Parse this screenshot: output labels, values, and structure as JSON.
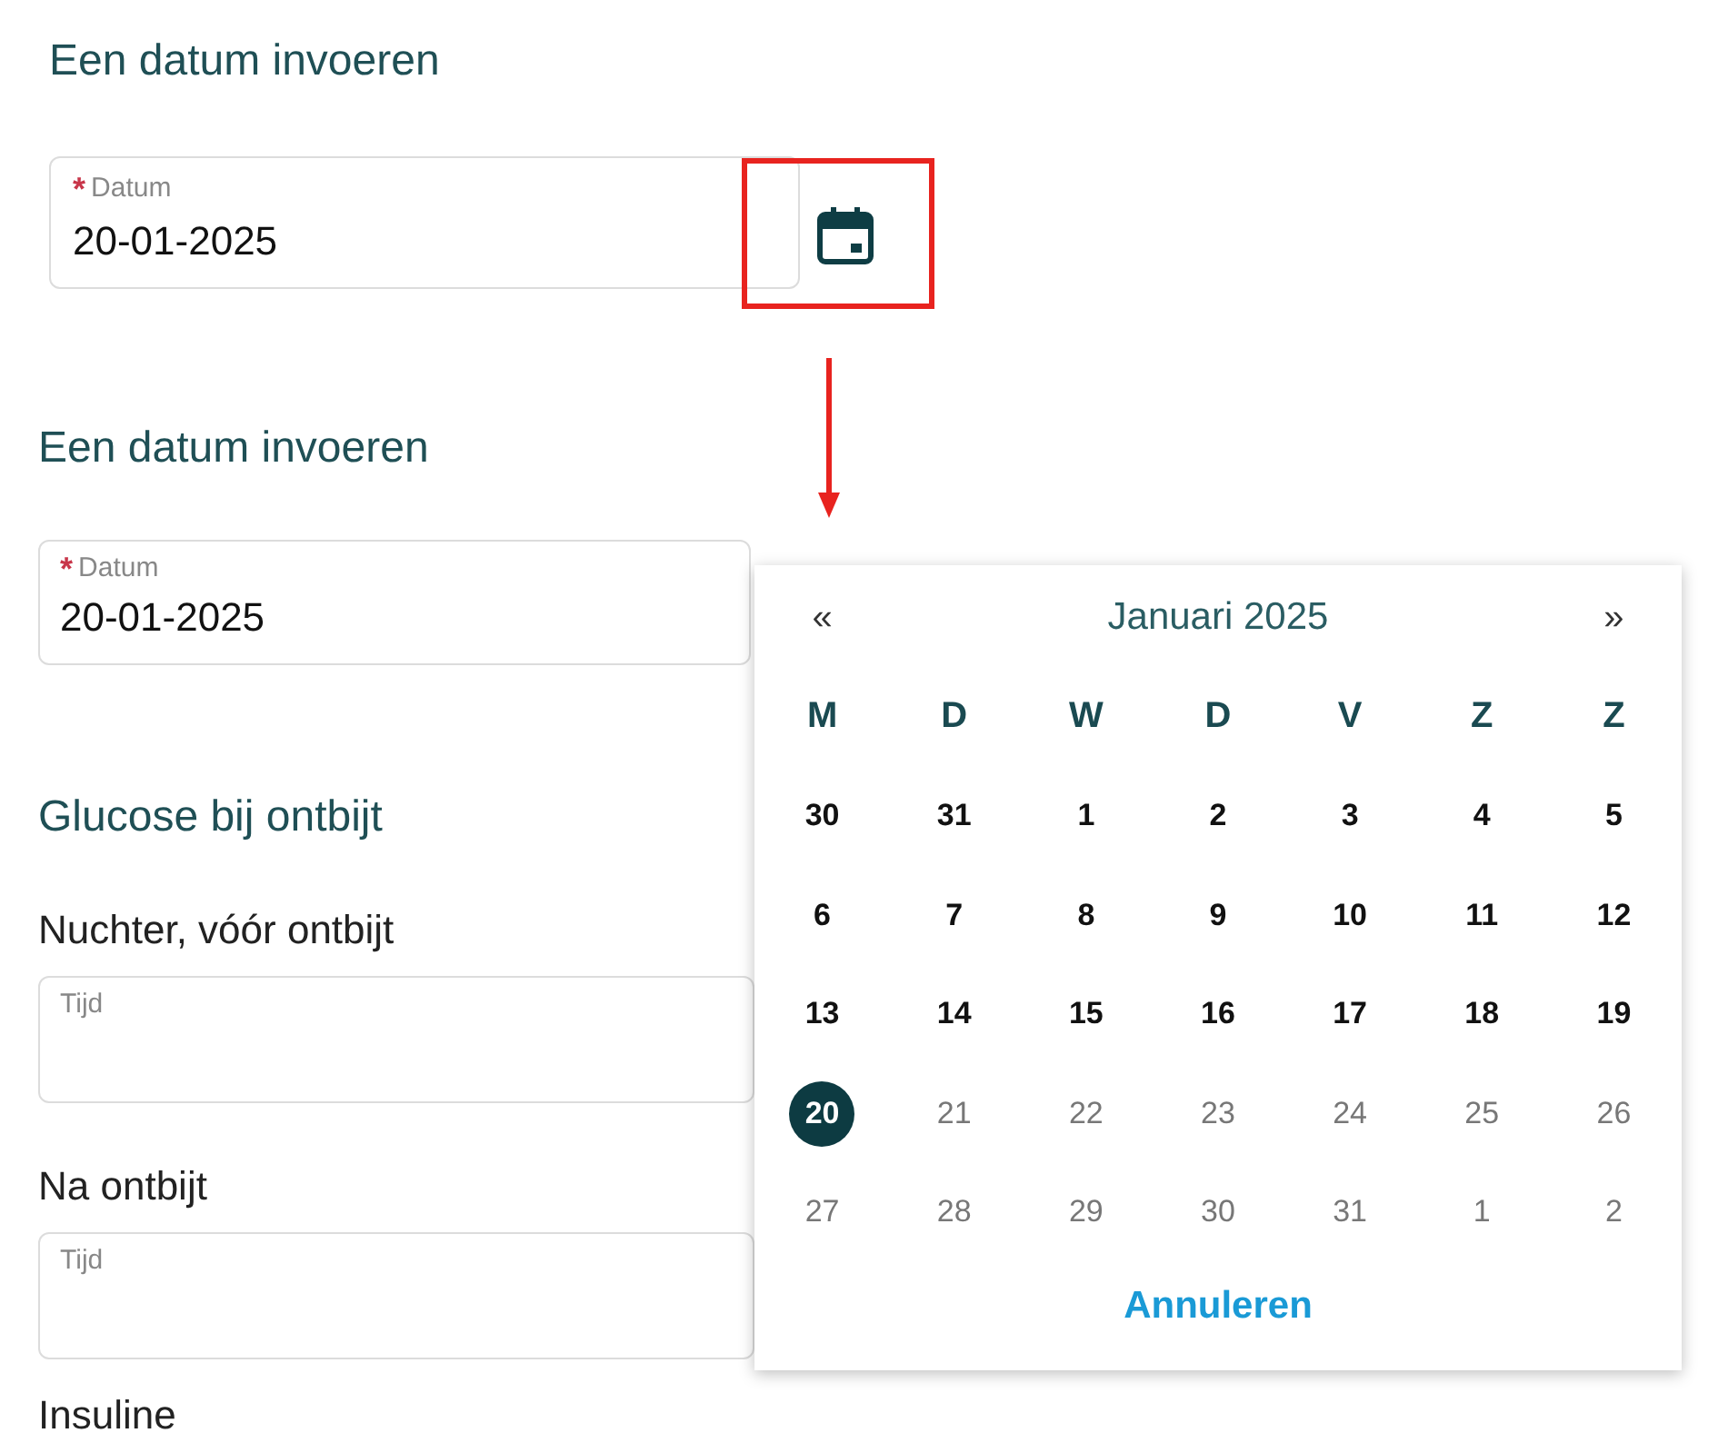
{
  "top": {
    "heading": "Een datum invoeren",
    "date_field": {
      "required_mark": "*",
      "label": "Datum",
      "value": "20-01-2025"
    }
  },
  "form": {
    "heading": "Een datum invoeren",
    "date_field": {
      "required_mark": "*",
      "label": "Datum",
      "value": "20-01-2025"
    },
    "group_heading": "Glucose bij ontbijt",
    "fields": [
      {
        "label": "Nuchter, vóór ontbijt",
        "field_label": "Tijd"
      },
      {
        "label": "Na ontbijt",
        "field_label": "Tijd"
      }
    ],
    "next_label": "Insuline"
  },
  "datepicker": {
    "prev": "«",
    "title": "Januari 2025",
    "next": "»",
    "weekdays": [
      "M",
      "D",
      "W",
      "D",
      "V",
      "Z",
      "Z"
    ],
    "weeks": [
      [
        {
          "label": "30",
          "selected": false,
          "disabled": false
        },
        {
          "label": "31",
          "selected": false,
          "disabled": false
        },
        {
          "label": "1",
          "selected": false,
          "disabled": false
        },
        {
          "label": "2",
          "selected": false,
          "disabled": false
        },
        {
          "label": "3",
          "selected": false,
          "disabled": false
        },
        {
          "label": "4",
          "selected": false,
          "disabled": false
        },
        {
          "label": "5",
          "selected": false,
          "disabled": false
        }
      ],
      [
        {
          "label": "6",
          "selected": false,
          "disabled": false
        },
        {
          "label": "7",
          "selected": false,
          "disabled": false
        },
        {
          "label": "8",
          "selected": false,
          "disabled": false
        },
        {
          "label": "9",
          "selected": false,
          "disabled": false
        },
        {
          "label": "10",
          "selected": false,
          "disabled": false
        },
        {
          "label": "11",
          "selected": false,
          "disabled": false
        },
        {
          "label": "12",
          "selected": false,
          "disabled": false
        }
      ],
      [
        {
          "label": "13",
          "selected": false,
          "disabled": false
        },
        {
          "label": "14",
          "selected": false,
          "disabled": false
        },
        {
          "label": "15",
          "selected": false,
          "disabled": false
        },
        {
          "label": "16",
          "selected": false,
          "disabled": false
        },
        {
          "label": "17",
          "selected": false,
          "disabled": false
        },
        {
          "label": "18",
          "selected": false,
          "disabled": false
        },
        {
          "label": "19",
          "selected": false,
          "disabled": false
        }
      ],
      [
        {
          "label": "20",
          "selected": true,
          "disabled": false
        },
        {
          "label": "21",
          "selected": false,
          "disabled": true
        },
        {
          "label": "22",
          "selected": false,
          "disabled": true
        },
        {
          "label": "23",
          "selected": false,
          "disabled": true
        },
        {
          "label": "24",
          "selected": false,
          "disabled": true
        },
        {
          "label": "25",
          "selected": false,
          "disabled": true
        },
        {
          "label": "26",
          "selected": false,
          "disabled": true
        }
      ],
      [
        {
          "label": "27",
          "selected": false,
          "disabled": true
        },
        {
          "label": "28",
          "selected": false,
          "disabled": true
        },
        {
          "label": "29",
          "selected": false,
          "disabled": true
        },
        {
          "label": "30",
          "selected": false,
          "disabled": true
        },
        {
          "label": "31",
          "selected": false,
          "disabled": true
        },
        {
          "label": "1",
          "selected": false,
          "disabled": true
        },
        {
          "label": "2",
          "selected": false,
          "disabled": true
        }
      ]
    ],
    "cancel": "Annuleren"
  }
}
